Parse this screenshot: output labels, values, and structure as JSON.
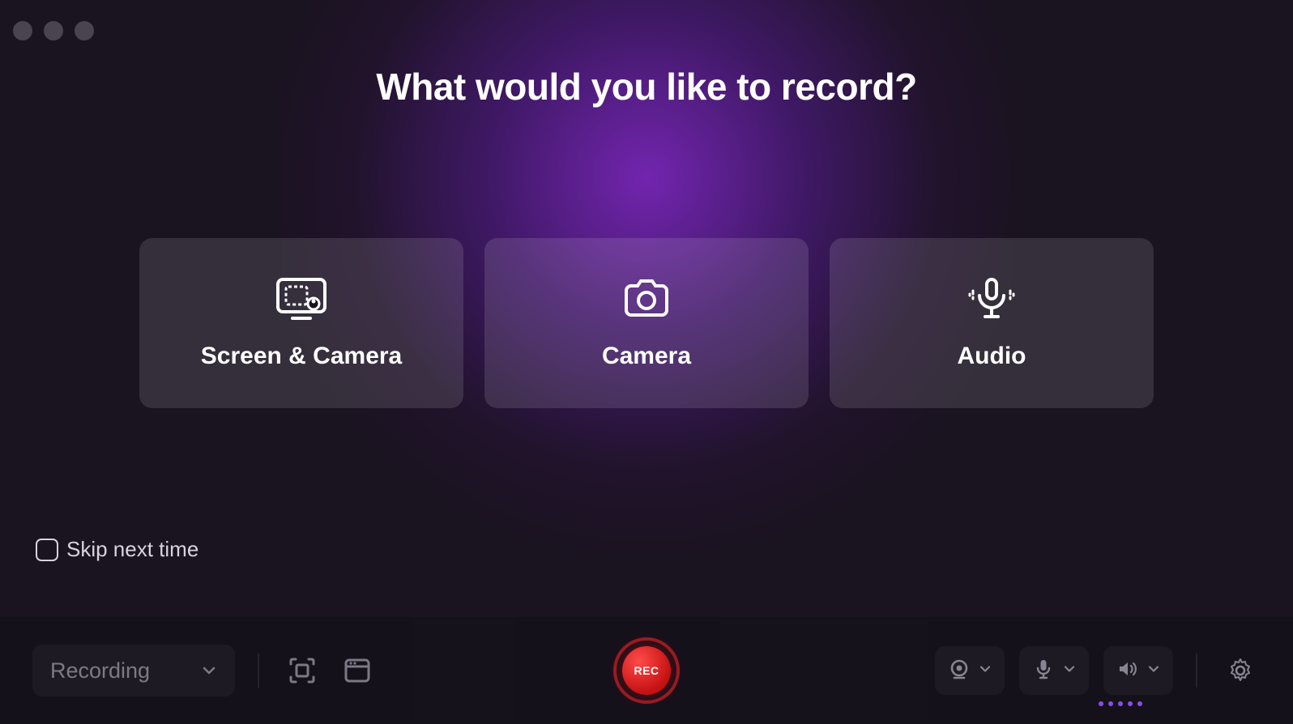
{
  "header": {
    "title": "What would you like to record?"
  },
  "options": {
    "screen_camera": "Screen & Camera",
    "camera": "Camera",
    "audio": "Audio"
  },
  "skip": {
    "label": "Skip next time"
  },
  "toolbar": {
    "mode_label": "Recording",
    "rec_label": "REC"
  }
}
